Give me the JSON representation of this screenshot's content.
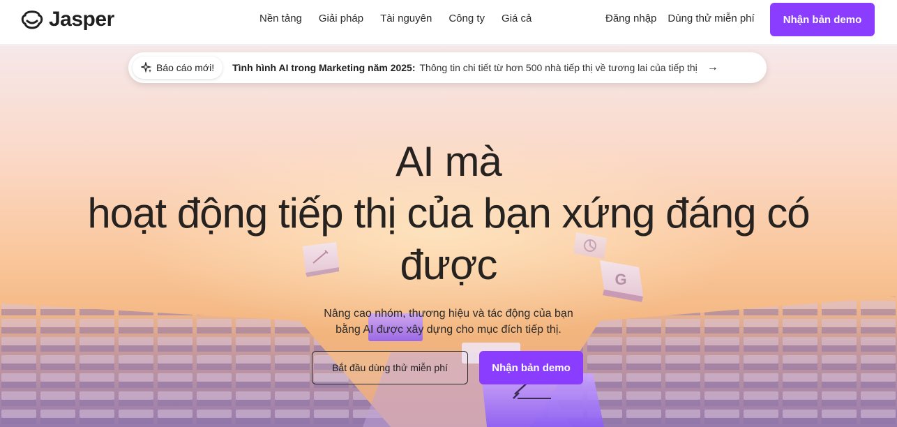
{
  "brand": {
    "name": "Jasper",
    "accent": "#8b3dff"
  },
  "nav": {
    "links": [
      "Nền tảng",
      "Giải pháp",
      "Tài nguyên",
      "Công ty",
      "Giá cả"
    ],
    "login": "Đăng nhập",
    "trial": "Dùng thử miễn phí",
    "demo": "Nhận bản demo"
  },
  "announcement": {
    "tag": "Báo cáo mới!",
    "title": "Tình hình AI trong Marketing năm 2025:",
    "description": "Thông tin chi tiết từ hơn 500 nhà tiếp thị về tương lai của tiếp thị",
    "icon": "sparkle-icon",
    "arrow_icon": "arrow-right-icon"
  },
  "hero": {
    "headline_line1": "AI mà",
    "headline_line2": "hoạt động tiếp thị của bạn xứng đáng có",
    "headline_line3": "được",
    "sub_line1": "Nâng cao nhóm, thương hiệu và tác động của bạn",
    "sub_line2": "bằng AI được xây dựng cho mục đích tiếp thị.",
    "cta_secondary": "Bắt đầu dùng thử miễn phí",
    "cta_primary": "Nhận bản demo",
    "floating_tiles": [
      "pencil-icon",
      "chart-icon",
      "G"
    ]
  }
}
